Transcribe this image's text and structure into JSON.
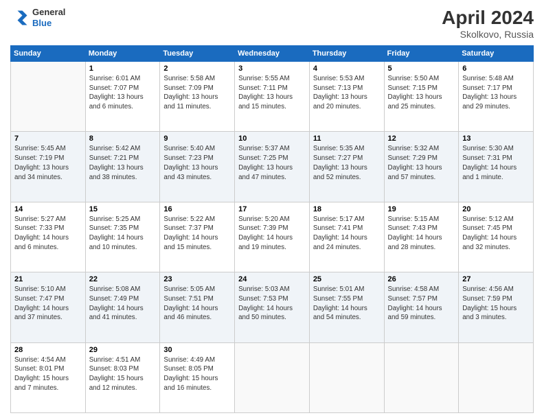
{
  "header": {
    "logo_line1": "General",
    "logo_line2": "Blue",
    "title": "April 2024",
    "subtitle": "Skolkovo, Russia"
  },
  "weekdays": [
    "Sunday",
    "Monday",
    "Tuesday",
    "Wednesday",
    "Thursday",
    "Friday",
    "Saturday"
  ],
  "weeks": [
    [
      {
        "date": "",
        "info": ""
      },
      {
        "date": "1",
        "info": "Sunrise: 6:01 AM\nSunset: 7:07 PM\nDaylight: 13 hours\nand 6 minutes."
      },
      {
        "date": "2",
        "info": "Sunrise: 5:58 AM\nSunset: 7:09 PM\nDaylight: 13 hours\nand 11 minutes."
      },
      {
        "date": "3",
        "info": "Sunrise: 5:55 AM\nSunset: 7:11 PM\nDaylight: 13 hours\nand 15 minutes."
      },
      {
        "date": "4",
        "info": "Sunrise: 5:53 AM\nSunset: 7:13 PM\nDaylight: 13 hours\nand 20 minutes."
      },
      {
        "date": "5",
        "info": "Sunrise: 5:50 AM\nSunset: 7:15 PM\nDaylight: 13 hours\nand 25 minutes."
      },
      {
        "date": "6",
        "info": "Sunrise: 5:48 AM\nSunset: 7:17 PM\nDaylight: 13 hours\nand 29 minutes."
      }
    ],
    [
      {
        "date": "7",
        "info": "Sunrise: 5:45 AM\nSunset: 7:19 PM\nDaylight: 13 hours\nand 34 minutes."
      },
      {
        "date": "8",
        "info": "Sunrise: 5:42 AM\nSunset: 7:21 PM\nDaylight: 13 hours\nand 38 minutes."
      },
      {
        "date": "9",
        "info": "Sunrise: 5:40 AM\nSunset: 7:23 PM\nDaylight: 13 hours\nand 43 minutes."
      },
      {
        "date": "10",
        "info": "Sunrise: 5:37 AM\nSunset: 7:25 PM\nDaylight: 13 hours\nand 47 minutes."
      },
      {
        "date": "11",
        "info": "Sunrise: 5:35 AM\nSunset: 7:27 PM\nDaylight: 13 hours\nand 52 minutes."
      },
      {
        "date": "12",
        "info": "Sunrise: 5:32 AM\nSunset: 7:29 PM\nDaylight: 13 hours\nand 57 minutes."
      },
      {
        "date": "13",
        "info": "Sunrise: 5:30 AM\nSunset: 7:31 PM\nDaylight: 14 hours\nand 1 minute."
      }
    ],
    [
      {
        "date": "14",
        "info": "Sunrise: 5:27 AM\nSunset: 7:33 PM\nDaylight: 14 hours\nand 6 minutes."
      },
      {
        "date": "15",
        "info": "Sunrise: 5:25 AM\nSunset: 7:35 PM\nDaylight: 14 hours\nand 10 minutes."
      },
      {
        "date": "16",
        "info": "Sunrise: 5:22 AM\nSunset: 7:37 PM\nDaylight: 14 hours\nand 15 minutes."
      },
      {
        "date": "17",
        "info": "Sunrise: 5:20 AM\nSunset: 7:39 PM\nDaylight: 14 hours\nand 19 minutes."
      },
      {
        "date": "18",
        "info": "Sunrise: 5:17 AM\nSunset: 7:41 PM\nDaylight: 14 hours\nand 24 minutes."
      },
      {
        "date": "19",
        "info": "Sunrise: 5:15 AM\nSunset: 7:43 PM\nDaylight: 14 hours\nand 28 minutes."
      },
      {
        "date": "20",
        "info": "Sunrise: 5:12 AM\nSunset: 7:45 PM\nDaylight: 14 hours\nand 32 minutes."
      }
    ],
    [
      {
        "date": "21",
        "info": "Sunrise: 5:10 AM\nSunset: 7:47 PM\nDaylight: 14 hours\nand 37 minutes."
      },
      {
        "date": "22",
        "info": "Sunrise: 5:08 AM\nSunset: 7:49 PM\nDaylight: 14 hours\nand 41 minutes."
      },
      {
        "date": "23",
        "info": "Sunrise: 5:05 AM\nSunset: 7:51 PM\nDaylight: 14 hours\nand 46 minutes."
      },
      {
        "date": "24",
        "info": "Sunrise: 5:03 AM\nSunset: 7:53 PM\nDaylight: 14 hours\nand 50 minutes."
      },
      {
        "date": "25",
        "info": "Sunrise: 5:01 AM\nSunset: 7:55 PM\nDaylight: 14 hours\nand 54 minutes."
      },
      {
        "date": "26",
        "info": "Sunrise: 4:58 AM\nSunset: 7:57 PM\nDaylight: 14 hours\nand 59 minutes."
      },
      {
        "date": "27",
        "info": "Sunrise: 4:56 AM\nSunset: 7:59 PM\nDaylight: 15 hours\nand 3 minutes."
      }
    ],
    [
      {
        "date": "28",
        "info": "Sunrise: 4:54 AM\nSunset: 8:01 PM\nDaylight: 15 hours\nand 7 minutes."
      },
      {
        "date": "29",
        "info": "Sunrise: 4:51 AM\nSunset: 8:03 PM\nDaylight: 15 hours\nand 12 minutes."
      },
      {
        "date": "30",
        "info": "Sunrise: 4:49 AM\nSunset: 8:05 PM\nDaylight: 15 hours\nand 16 minutes."
      },
      {
        "date": "",
        "info": ""
      },
      {
        "date": "",
        "info": ""
      },
      {
        "date": "",
        "info": ""
      },
      {
        "date": "",
        "info": ""
      }
    ]
  ]
}
